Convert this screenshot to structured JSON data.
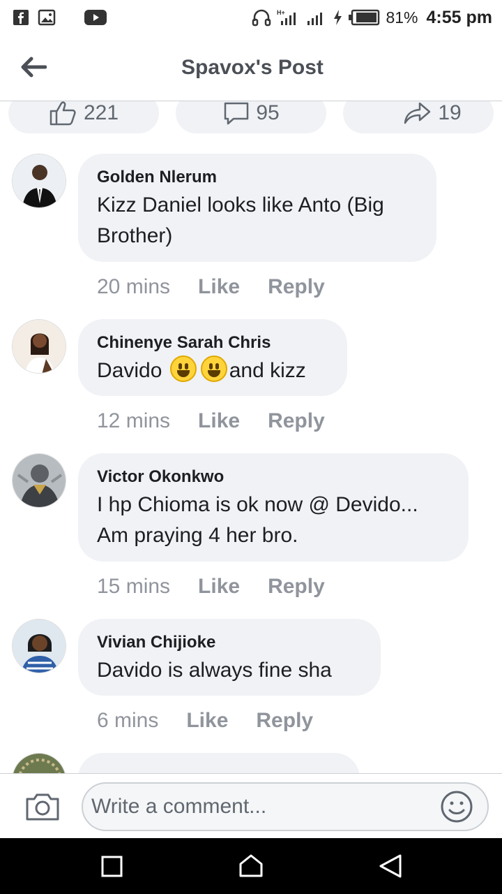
{
  "status_bar": {
    "battery": "81%",
    "time": "4:55 pm",
    "network": "H+"
  },
  "header": {
    "title": "Spavox's Post"
  },
  "reactions": {
    "likes": "221",
    "comments": "95",
    "shares": "19"
  },
  "comments": [
    {
      "name": "Golden Nlerum",
      "text_lines": [
        "Kizz Daniel looks like Anto (Big",
        "Brother)"
      ],
      "time": "20 mins",
      "like": "Like",
      "reply": "Reply"
    },
    {
      "name": "Chinenye Sarah Chris",
      "text_before": "Davido",
      "text_after": "and kizz",
      "time": "12 mins",
      "like": "Like",
      "reply": "Reply"
    },
    {
      "name": "Victor Okonkwo",
      "text_lines": [
        "I hp Chioma is ok now @ Devido...",
        "Am praying 4 her bro."
      ],
      "time": "15 mins",
      "like": "Like",
      "reply": "Reply"
    },
    {
      "name": "Vivian Chijioke",
      "text_lines": [
        "Davido is always fine sha"
      ],
      "time": "6 mins",
      "like": "Like",
      "reply": "Reply"
    }
  ],
  "composer": {
    "placeholder": "Write a comment..."
  },
  "icons": {
    "back": "arrow-left-icon",
    "like": "thumbs-up-icon",
    "comment": "speech-bubble-icon",
    "share": "share-arrow-icon",
    "camera": "camera-icon",
    "emoji": "smiley-icon"
  },
  "colors": {
    "bubble": "#f0f2f5",
    "muted": "#90949c",
    "title": "#4b4f56"
  }
}
